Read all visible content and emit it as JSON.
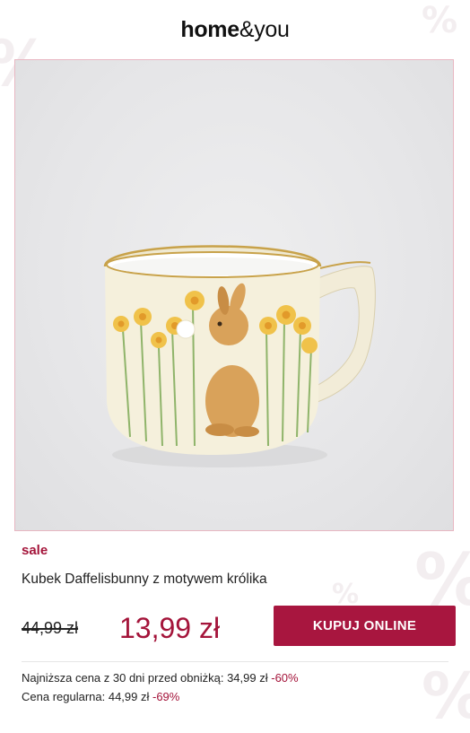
{
  "brand": {
    "bold": "home",
    "amp": "&",
    "light": "you"
  },
  "product": {
    "image_alt": "Kubek z motywem królika i żonkili",
    "badge": "sale",
    "name": "Kubek Daffelisbunny z motywem królika",
    "old_price": "44,99 zł",
    "new_price": "13,99 zł",
    "buy_label": "KUPUJ ONLINE"
  },
  "info": {
    "lowest_label": "Najniższa cena z 30 dni przed obniżką: 34,99 zł",
    "lowest_pct": "-60%",
    "regular_label": "Cena regularna: 44,99 zł",
    "regular_pct": "-69%"
  },
  "colors": {
    "accent": "#a8163f",
    "frame": "#e8b7c2",
    "image_bg": "#e6e6e8"
  }
}
